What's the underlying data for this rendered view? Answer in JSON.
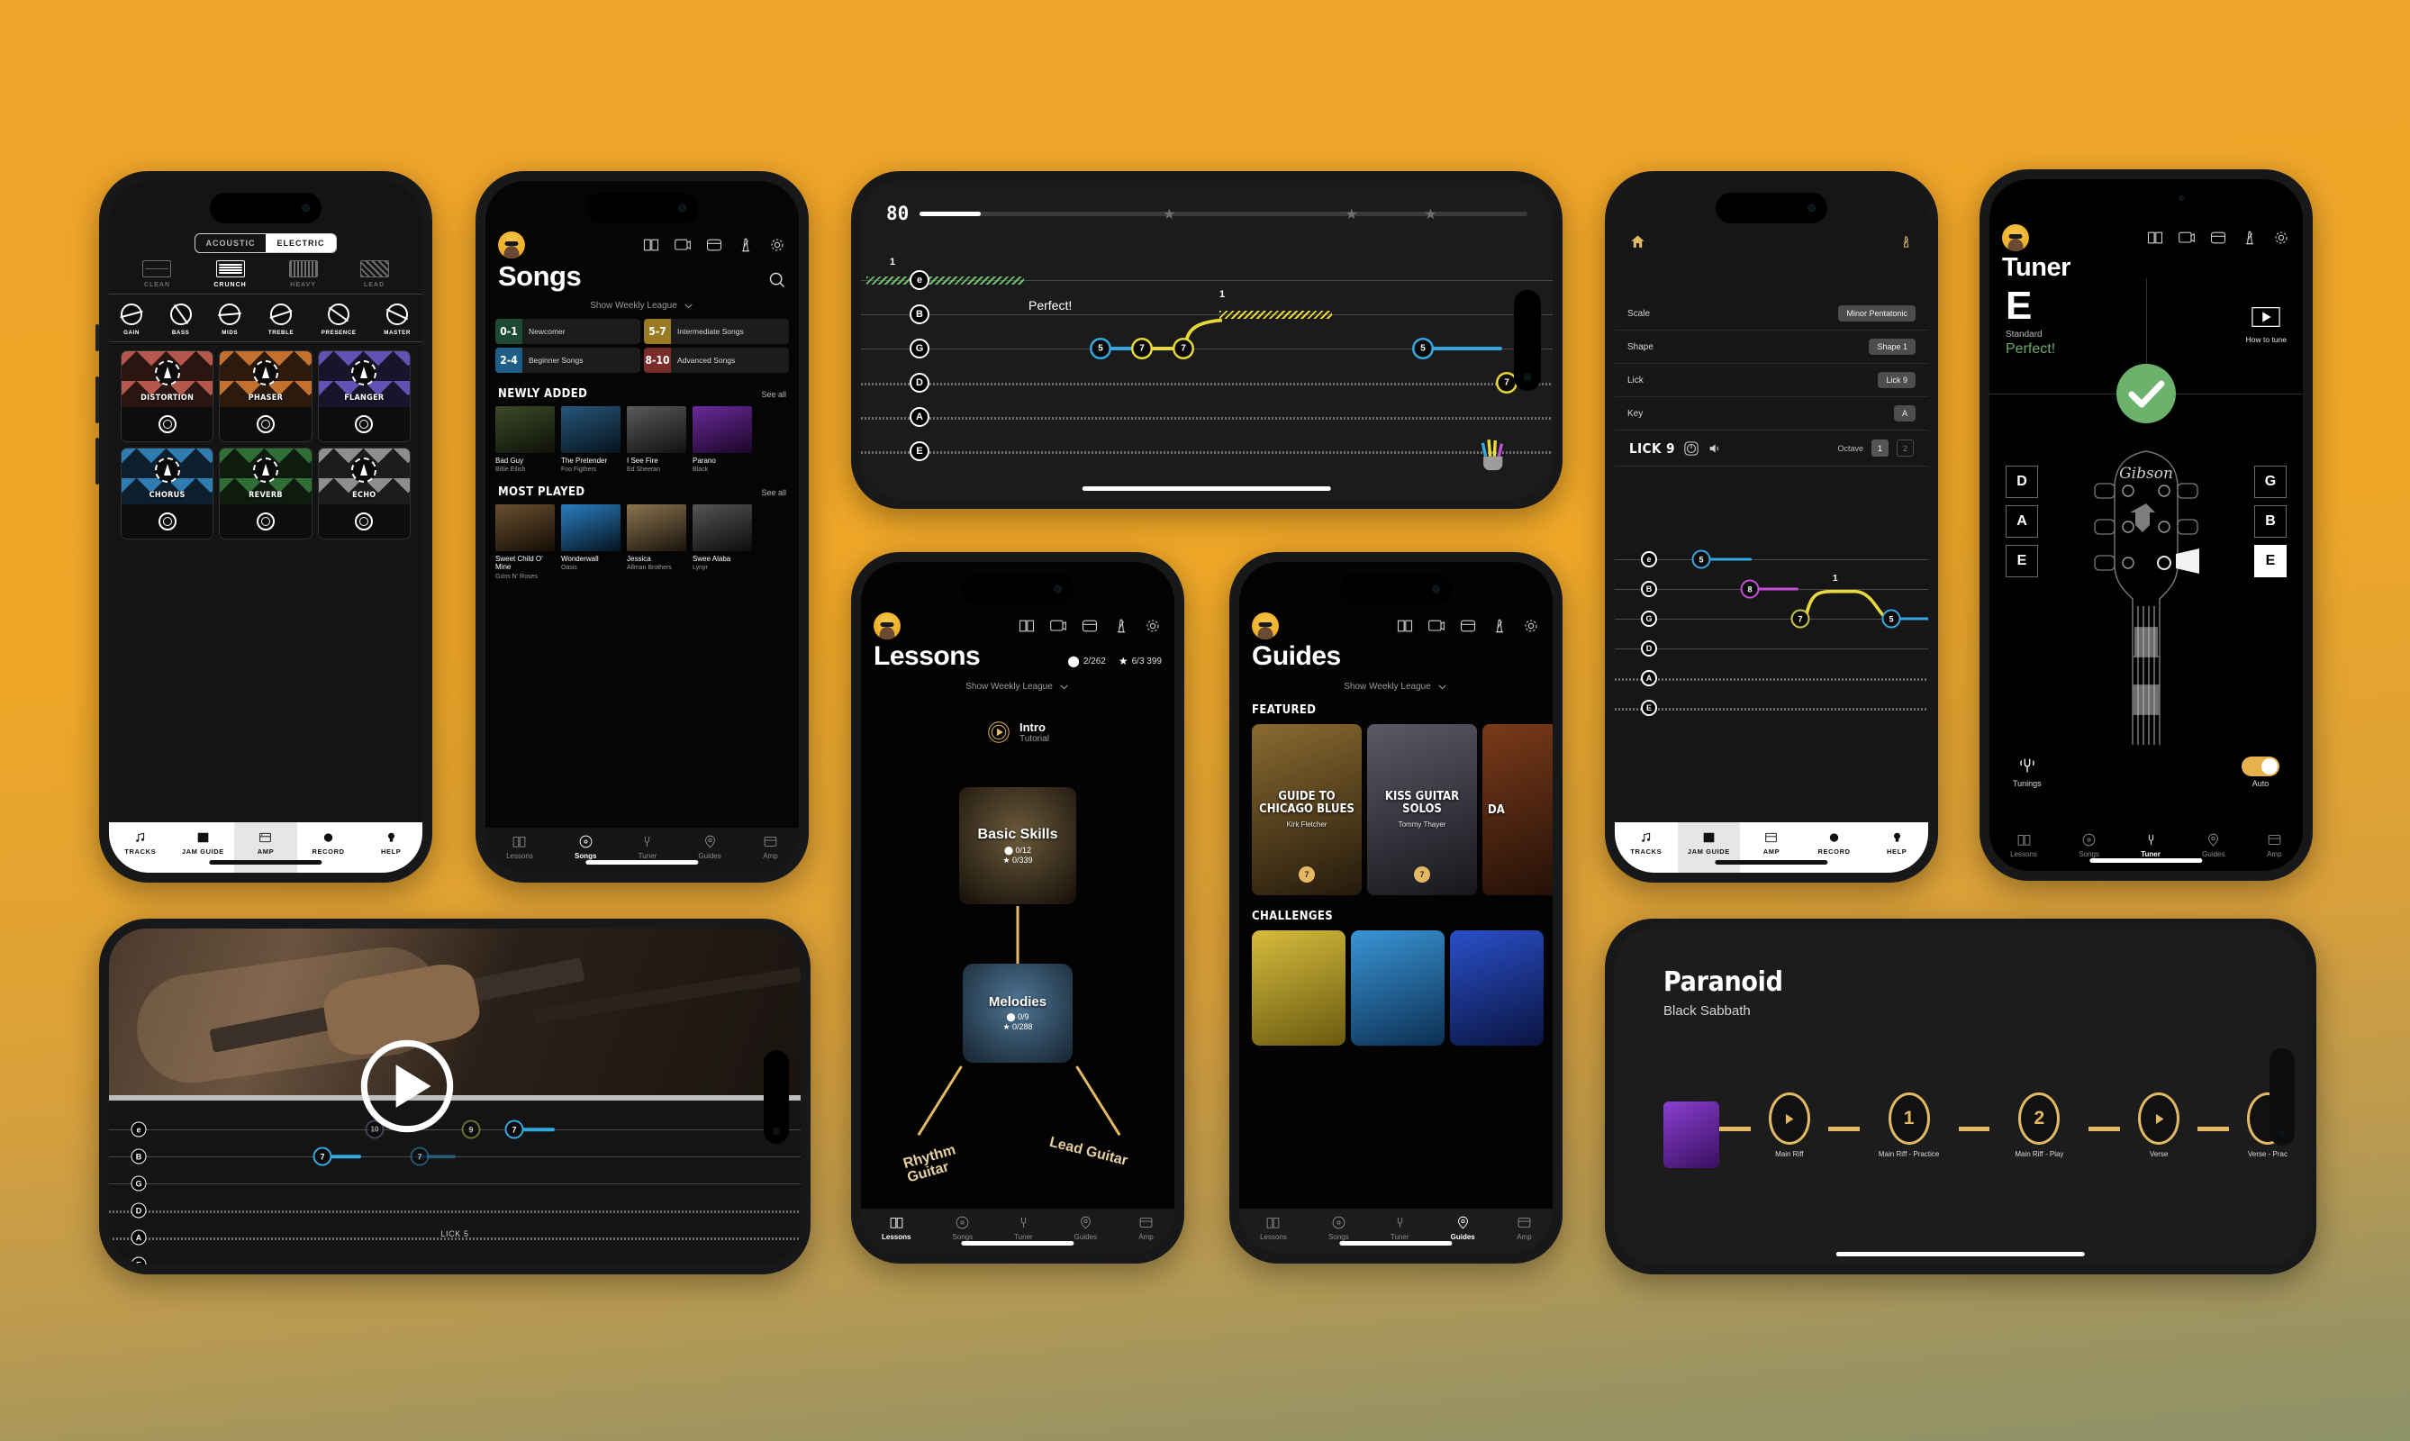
{
  "app": {
    "accent": "#e3b964",
    "background_top": "#f0a42a",
    "background_bottom": "#8d9268"
  },
  "amp_screen": {
    "segment": {
      "options": [
        "ACOUSTIC",
        "ELECTRIC"
      ],
      "selected": "ELECTRIC"
    },
    "modes": [
      {
        "label": "CLEAN",
        "active": false
      },
      {
        "label": "CRUNCH",
        "active": true
      },
      {
        "label": "HEAVY",
        "active": false
      },
      {
        "label": "LEAD",
        "active": false
      }
    ],
    "knobs": [
      {
        "label": "GAIN",
        "angle": "-15deg"
      },
      {
        "label": "BASS",
        "angle": "55deg"
      },
      {
        "label": "MIDS",
        "angle": "-5deg"
      },
      {
        "label": "TREBLE",
        "angle": "-18deg"
      },
      {
        "label": "PRESENCE",
        "angle": "35deg"
      },
      {
        "label": "MASTER",
        "angle": "25deg"
      }
    ],
    "pedals": [
      {
        "name": "DISTORTION",
        "color": "#b4584c"
      },
      {
        "name": "PHASER",
        "color": "#c2712f"
      },
      {
        "name": "FLANGER",
        "color": "#6252b4"
      },
      {
        "name": "CHORUS",
        "color": "#2f7cb0"
      },
      {
        "name": "REVERB",
        "color": "#2f6f35"
      },
      {
        "name": "ECHO",
        "color": "#8e8e8e"
      }
    ],
    "tabs": [
      {
        "label": "TRACKS",
        "icon": "music-note-icon",
        "active": false
      },
      {
        "label": "JAM GUIDE",
        "icon": "grid-icon",
        "active": false
      },
      {
        "label": "AMP",
        "icon": "amp-icon",
        "active": true
      },
      {
        "label": "RECORD",
        "icon": "record-dot-icon",
        "active": false
      },
      {
        "label": "HELP",
        "icon": "lightbulb-icon",
        "active": false
      }
    ]
  },
  "songs_screen": {
    "title": "Songs",
    "weekly_league": "Show Weekly League",
    "header_icons": [
      "book-icon",
      "video-icon",
      "amp-icon",
      "metronome-icon",
      "gear-icon"
    ],
    "search_icon": "search-icon",
    "leagues": [
      {
        "range": "0-1",
        "label": "Newcomer",
        "color": "#1d4a33"
      },
      {
        "range": "5-7",
        "label": "Intermediate Songs",
        "color": "#9a7a22"
      },
      {
        "range": "2-4",
        "label": "Beginner Songs",
        "color": "#1f5e86"
      },
      {
        "range": "8-10",
        "label": "Advanced Songs",
        "color": "#7c2b2b"
      }
    ],
    "sections": [
      {
        "title": "NEWLY ADDED",
        "see_all": "See all",
        "items": [
          {
            "title": "Bad Guy",
            "artist": "Billie Eilish",
            "color": "#2e3a22"
          },
          {
            "title": "The Pretender",
            "artist": "Foo Figthers",
            "color": "#1d3c55"
          },
          {
            "title": "I See Fire",
            "artist": "Ed Sheeran",
            "color": "#3b3b3b"
          },
          {
            "title": "Parano",
            "artist": "Black",
            "color": "#4b2266"
          }
        ]
      },
      {
        "title": "MOST PLAYED",
        "see_all": "See all",
        "items": [
          {
            "title": "Sweet Child O' Mine",
            "artist": "Guns N' Roses",
            "color": "#4a3a2a"
          },
          {
            "title": "Wonderwall",
            "artist": "Oasis",
            "color": "#1c4f7a"
          },
          {
            "title": "Jessica",
            "artist": "Allman Brothers",
            "color": "#5a4b35"
          },
          {
            "title": "Swee Alaba",
            "artist": "Lynyr",
            "color": "#333333"
          }
        ]
      }
    ],
    "tabs": [
      {
        "label": "Lessons",
        "icon": "book-open-icon",
        "active": false
      },
      {
        "label": "Songs",
        "icon": "disc-icon",
        "active": true
      },
      {
        "label": "Tuner",
        "icon": "tuning-fork-icon",
        "active": false
      },
      {
        "label": "Guides",
        "icon": "pin-icon",
        "active": false
      },
      {
        "label": "Amp",
        "icon": "amp-icon",
        "active": false
      }
    ]
  },
  "tab_player_landscape": {
    "tempo": "80",
    "feedback": "Perfect!",
    "stars": 3,
    "progress_percent": 10,
    "strings": [
      "e",
      "B",
      "G",
      "D",
      "A",
      "E"
    ],
    "notes": [
      {
        "fret": "5",
        "string": "G",
        "color": "#35a8e0",
        "x": 27,
        "tail": 36
      },
      {
        "fret": "7",
        "string": "G",
        "color": "#e8d93a",
        "x": 38,
        "tail": 46
      },
      {
        "fret": "7",
        "string": "G",
        "color": "#e8d93a",
        "x": 48,
        "tail": 0
      },
      {
        "fret": "5",
        "string": "G",
        "color": "#35a8e0",
        "x": 82,
        "tail": 92
      },
      {
        "fret": "7",
        "string": "D",
        "color": "#e8d93a",
        "x": 95,
        "tail": 0
      }
    ],
    "bend_labels": [
      "1",
      "1"
    ],
    "hand_icon": "hand-icon"
  },
  "lessons_screen": {
    "title": "Lessons",
    "weekly_league": "Show Weekly League",
    "pick_stat": "2/262",
    "star_stat": "6/3 399",
    "intro": {
      "title": "Intro",
      "subtitle": "Tutorial",
      "icon": "play-circle-icon"
    },
    "nodes": [
      {
        "title": "Basic Skills",
        "picks": "0/12",
        "stars": "0/339",
        "color": "#3a3428"
      },
      {
        "title": "Melodies",
        "picks": "0/9",
        "stars": "0/288",
        "color": "#3c5a74"
      }
    ],
    "branches": [
      "Rhythm Guitar",
      "Lead Guitar"
    ],
    "tabs": [
      {
        "label": "Lessons",
        "icon": "book-open-icon",
        "active": true
      },
      {
        "label": "Songs",
        "icon": "disc-icon",
        "active": false
      },
      {
        "label": "Tuner",
        "icon": "tuning-fork-icon",
        "active": false
      },
      {
        "label": "Guides",
        "icon": "pin-icon",
        "active": false
      },
      {
        "label": "Amp",
        "icon": "amp-icon",
        "active": false
      }
    ]
  },
  "guides_screen": {
    "title": "Guides",
    "weekly_league": "Show Weekly League",
    "featured_label": "FEATURED",
    "challenges_label": "CHALLENGES",
    "featured": [
      {
        "title": "GUIDE TO CHICAGO BLUES",
        "author": "Kirk Fletcher",
        "badge": "7",
        "color": "#4a3a22"
      },
      {
        "title": "KISS GUITAR SOLOS",
        "author": "Tommy Thayer",
        "badge": "7",
        "color": "#3a3a42"
      },
      {
        "title": "DA",
        "author": "",
        "badge": "",
        "color": "#4a2a1a"
      }
    ],
    "challenges": [
      {
        "color": "#b9a335"
      },
      {
        "color": "#2f7ac4"
      },
      {
        "color": "#1d3fa8"
      }
    ],
    "tabs": [
      {
        "label": "Lessons",
        "icon": "book-open-icon",
        "active": false
      },
      {
        "label": "Songs",
        "icon": "disc-icon",
        "active": false
      },
      {
        "label": "Tuner",
        "icon": "tuning-fork-icon",
        "active": false
      },
      {
        "label": "Guides",
        "icon": "pin-icon",
        "active": true
      },
      {
        "label": "Amp",
        "icon": "amp-icon",
        "active": false
      }
    ]
  },
  "jamguide_screen": {
    "home_icon": "home-icon",
    "metronome_icon": "metronome-icon",
    "rows": [
      {
        "label": "Scale",
        "value": "Minor Pentatonic"
      },
      {
        "label": "Shape",
        "value": "Shape 1"
      },
      {
        "label": "Lick",
        "value": "Lick 9"
      },
      {
        "label": "Key",
        "value": "A"
      }
    ],
    "current_lick": "LICK 9",
    "speed_icon": "speed-icon",
    "volume_icon": "volume-icon",
    "octave_label": "Octave",
    "octaves": [
      {
        "value": "1",
        "active": true
      },
      {
        "value": "2",
        "active": false
      }
    ],
    "strings": [
      "e",
      "B",
      "G",
      "D",
      "A",
      "E"
    ],
    "notes": [
      {
        "fret": "5",
        "string": "e",
        "color": "#35a8e0",
        "x": 17,
        "tail": 34
      },
      {
        "fret": "8",
        "string": "B",
        "color": "#c24fd6",
        "x": 33,
        "tail": 50
      },
      {
        "fret": "7",
        "string": "G",
        "color": "#e8d93a",
        "x": 47,
        "tail": 0
      },
      {
        "fret": "5",
        "string": "G",
        "color": "#35a8e0",
        "x": 76,
        "tail": 100
      }
    ],
    "bend_label": "1",
    "tabs": [
      {
        "label": "TRACKS",
        "icon": "music-note-icon",
        "active": false
      },
      {
        "label": "JAM GUIDE",
        "icon": "grid-icon",
        "active": true
      },
      {
        "label": "AMP",
        "icon": "amp-icon",
        "active": false
      },
      {
        "label": "RECORD",
        "icon": "record-dot-icon",
        "active": false
      },
      {
        "label": "HELP",
        "icon": "lightbulb-icon",
        "active": false
      }
    ]
  },
  "tuner_screen": {
    "title": "Tuner",
    "note": "E",
    "tuning_name": "Standard",
    "status": "Perfect!",
    "status_color": "#6ca96c",
    "how_to_tune": "How to tune",
    "check_icon": "check-circle-icon",
    "brand": "Gibson",
    "left_notes": [
      {
        "label": "D",
        "active": false
      },
      {
        "label": "A",
        "active": false
      },
      {
        "label": "E",
        "active": false
      }
    ],
    "right_notes": [
      {
        "label": "G",
        "active": false
      },
      {
        "label": "B",
        "active": false
      },
      {
        "label": "E",
        "active": true
      }
    ],
    "tunings_label": "Tunings",
    "auto_label": "Auto",
    "auto_on": true,
    "tabs": [
      {
        "label": "Lessons",
        "icon": "book-open-icon",
        "active": false
      },
      {
        "label": "Songs",
        "icon": "disc-icon",
        "active": false
      },
      {
        "label": "Tuner",
        "icon": "tuning-fork-icon",
        "active": true
      },
      {
        "label": "Guides",
        "icon": "pin-icon",
        "active": false
      },
      {
        "label": "Amp",
        "icon": "amp-icon",
        "active": false
      }
    ]
  },
  "video_screen": {
    "play_icon": "play-button-icon",
    "lick_label": "LICK 5",
    "strings": [
      "e",
      "B",
      "G",
      "D",
      "A",
      "E"
    ],
    "notes": [
      {
        "fret": "7",
        "string": "B",
        "color": "#35a8e0",
        "x": 28,
        "tail": 34
      },
      {
        "fret": "10",
        "string": "e",
        "color": "#9a7fd0",
        "x": 36,
        "tail": 0
      },
      {
        "fret": "7",
        "string": "B",
        "color": "#2a7fa8",
        "x": 42,
        "tail": 50
      },
      {
        "fret": "9",
        "string": "e",
        "color": "#8a9a3a",
        "x": 50,
        "tail": 0
      },
      {
        "fret": "7",
        "string": "e",
        "color": "#35a8e0",
        "x": 57,
        "tail": 64
      }
    ]
  },
  "paranoid_screen": {
    "title": "Paranoid",
    "artist": "Black Sabbath",
    "steps": [
      {
        "type": "play",
        "label": "Main Riff"
      },
      {
        "type": "number",
        "value": "1",
        "label": "Main Riff - Practice"
      },
      {
        "type": "number",
        "value": "2",
        "label": "Main Riff - Play"
      },
      {
        "type": "play",
        "label": "Verse"
      },
      {
        "type": "play",
        "label": "Verse - Prac"
      }
    ]
  }
}
